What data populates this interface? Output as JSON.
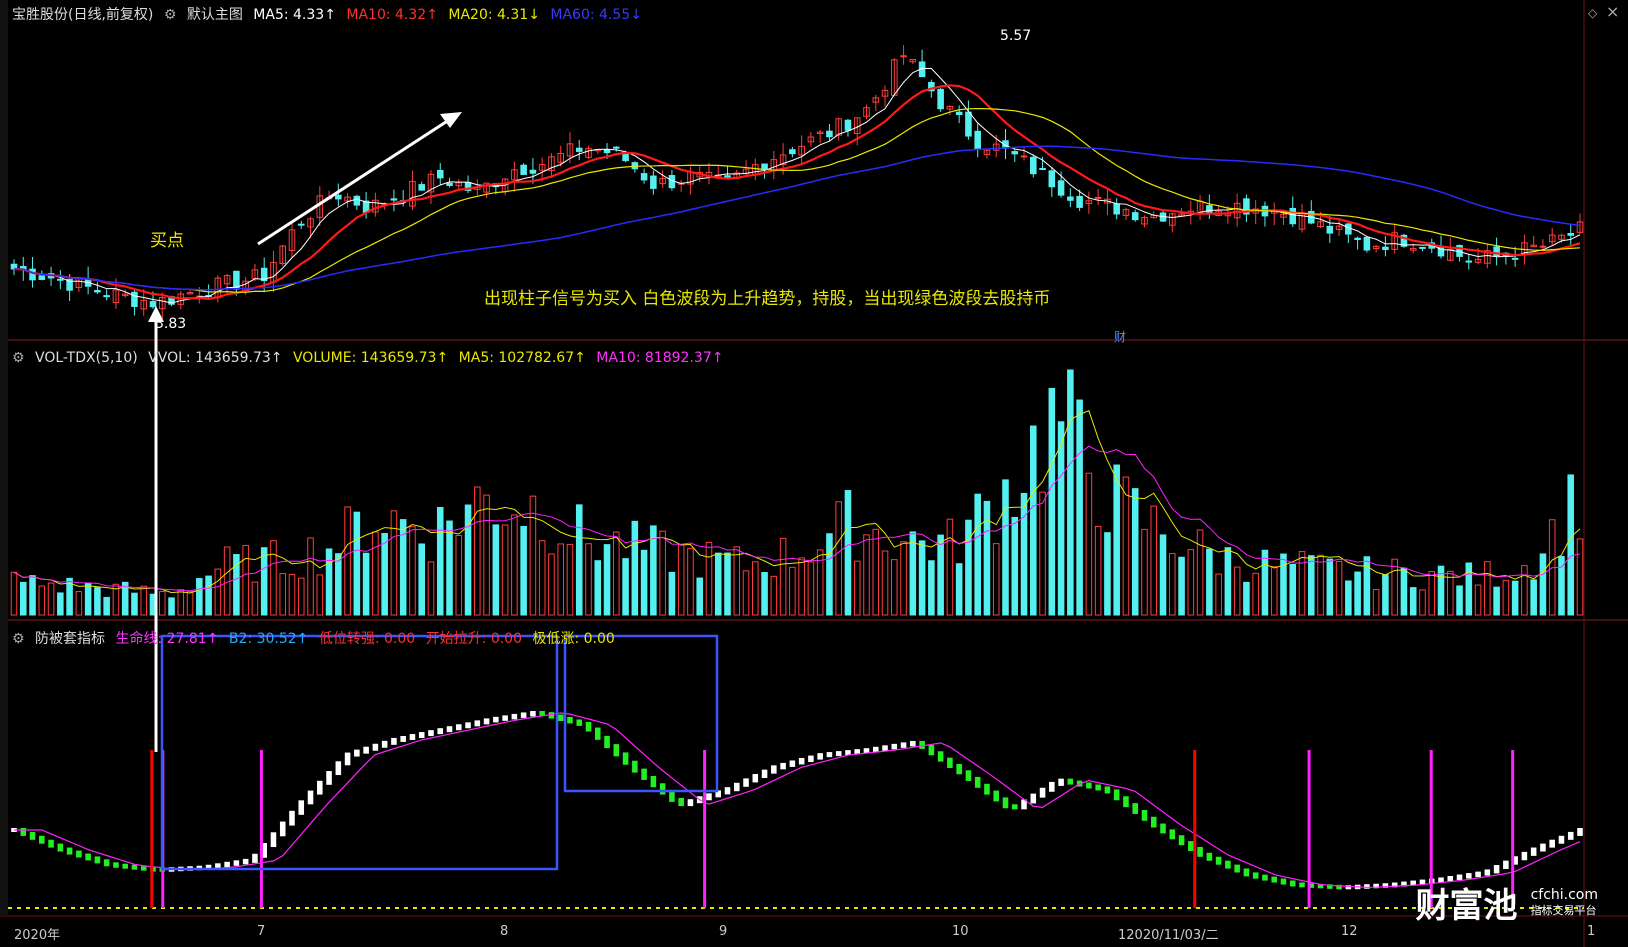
{
  "header_main": {
    "title": "宝胜股份(日线,前复权)",
    "subtitle": "默认主图",
    "ma5": "MA5: 4.33↑",
    "ma10": "MA10: 4.32↑",
    "ma20": "MA20: 4.31↓",
    "ma60": "MA60: 4.55↓"
  },
  "header_vol": {
    "title": "VOL-TDX(5,10)",
    "vvol": "VVOL: 143659.73↑",
    "volume": "VOLUME: 143659.73↑",
    "ma5": "MA5: 102782.67↑",
    "ma10": "MA10: 81892.37↑"
  },
  "header_ind": {
    "title": "防被套指标",
    "life": "生命线: 27.81↑",
    "b2": "B2: 30.52↑",
    "low_turn": "低位转强: 0.00",
    "start_lift": "开始拉升: 0.00",
    "extreme_low": "极低涨: 0.00"
  },
  "annotations": {
    "buy_point": "买点",
    "strategy": "出现柱子信号为买入 白色波段为上升趋势，持股，当出现绿色波段去股持币",
    "high_label": "5.57",
    "low_label": "3.83",
    "cai_marker": "财"
  },
  "x_labels": [
    "2020年",
    "7",
    "8",
    "9",
    "10",
    "12020/11/03/二",
    "12",
    "1"
  ],
  "watermark": {
    "brand": "财富池",
    "site": "cfchi.com",
    "tagline": "指标交易平台"
  },
  "colors": {
    "up": "#ff3d3d",
    "down": "#54f0f0",
    "ma5": "#ffffff",
    "ma10": "#ff1a1a",
    "ma20": "#e8e800",
    "ma60": "#2a2aff",
    "ind_up": "#ffffff",
    "ind_down": "#22ee22",
    "signal_red": "#ff0000",
    "signal_magenta": "#ff22ff",
    "box": "#3a55ff",
    "arrow": "#ffffff"
  },
  "chart_data": [
    {
      "type": "candlestick",
      "title": "宝胜股份(日线,前复权)",
      "series": [
        {
          "name": "MA5"
        },
        {
          "name": "MA10"
        },
        {
          "name": "MA20"
        },
        {
          "name": "MA60"
        }
      ],
      "ylim": [
        3.7,
        5.7
      ],
      "price_anchors": [
        4.1,
        4.05,
        3.98,
        3.92,
        3.88,
        3.95,
        4.0,
        4.05,
        4.4,
        4.6,
        4.5,
        4.6,
        4.7,
        4.6,
        4.75,
        4.8,
        4.9,
        4.85,
        4.65,
        4.7,
        4.65,
        4.8,
        4.9,
        5.0,
        5.15,
        5.5,
        5.2,
        4.95,
        4.85,
        4.7,
        4.55,
        4.5,
        4.45,
        4.5,
        4.52,
        4.5,
        4.45,
        4.35,
        4.25,
        4.3,
        4.25,
        4.15,
        4.2,
        4.25,
        4.35
      ],
      "high": 5.57,
      "low": 3.83
    },
    {
      "type": "bar",
      "title": "VOL-TDX(5,10)",
      "series": [
        {
          "name": "VOLUME"
        },
        {
          "name": "MA5"
        },
        {
          "name": "MA10"
        }
      ],
      "last_volume": 143659.73,
      "volume_anchors": [
        40000,
        35000,
        30000,
        25000,
        60000,
        65000,
        80000,
        120000,
        100000,
        140000,
        130000,
        90000,
        80000,
        70000,
        60000,
        75000,
        110000,
        90000,
        85000,
        150000,
        240000,
        140000,
        100000,
        70000,
        60000,
        55000,
        50000,
        50000,
        45000,
        60000,
        143659.73
      ]
    },
    {
      "type": "bar",
      "title": "防被套指标",
      "series": [
        {
          "name": "生命线"
        },
        {
          "name": "B2"
        }
      ],
      "last_values": {
        "生命线": 27.81,
        "B2": 30.52
      },
      "ylim": [
        0,
        100
      ],
      "line_anchors": [
        30,
        22,
        16,
        14,
        15,
        18,
        40,
        60,
        66,
        70,
        74,
        77,
        72,
        55,
        40,
        46,
        55,
        60,
        62,
        65,
        52,
        38,
        50,
        46,
        32,
        20,
        12,
        8,
        7,
        8,
        10,
        13,
        22,
        30
      ]
    }
  ]
}
